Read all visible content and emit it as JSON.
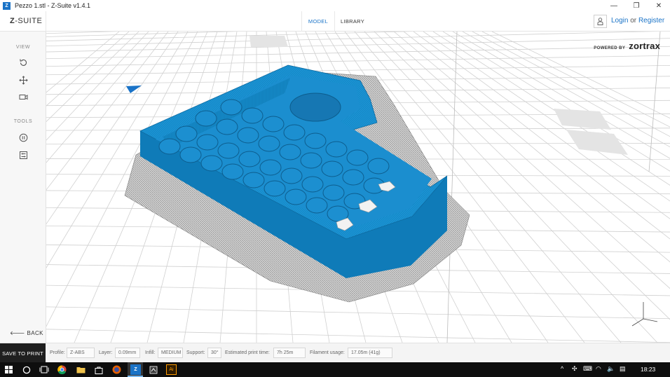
{
  "window": {
    "title": "Pezzo 1.stl - Z-Suite v1.4.1",
    "app_icon_letter": "Z",
    "controls": {
      "minimize": "—",
      "restore": "❐",
      "close": "✕"
    }
  },
  "header": {
    "logo_z": "Z",
    "logo_rest": "-SUITE",
    "tabs": [
      {
        "label": "MODEL",
        "active": true
      },
      {
        "label": "LIBRARY",
        "active": false
      }
    ],
    "login": "Login",
    "or": "or",
    "register": "Register"
  },
  "sidebar": {
    "view_label": "VIEW",
    "tools_label": "TOOLS",
    "back_label": "BACK",
    "icons": [
      "rotate-icon",
      "move-icon",
      "camera-icon",
      "pause-icon",
      "settings-icon"
    ]
  },
  "viewport": {
    "powered_by": "POWERED BY",
    "brand": "zortrax",
    "model_color": "#1488c6",
    "raft_color": "#bdbdbd"
  },
  "statusbar": {
    "save_label": "SAVE TO PRINT",
    "profile_label": "Profile:",
    "profile_value": "Z-ABS",
    "layer_label": "Layer:",
    "layer_value": "0.09mm",
    "infill_label": "Infill:",
    "infill_value": "MEDIUM",
    "support_label": "Support:",
    "support_value": "30°",
    "time_label": "Estimated print time:",
    "time_value": "7h 25m",
    "filament_label": "Filament usage:",
    "filament_value": "17.05m (41g)"
  },
  "taskbar": {
    "clock": "18:23",
    "accent": "#7ab8ee"
  }
}
